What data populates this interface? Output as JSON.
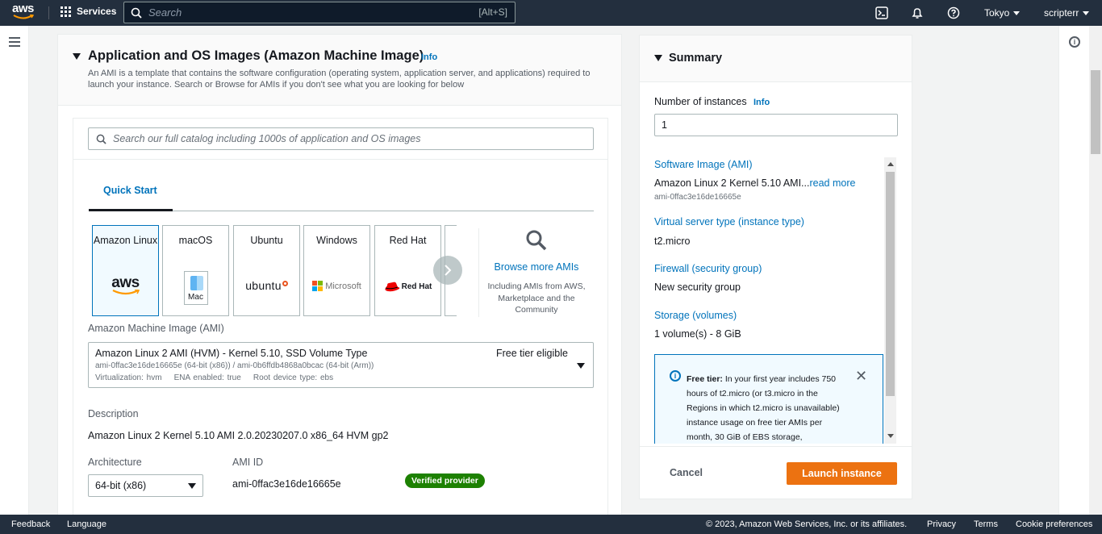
{
  "topnav": {
    "logo": "aws",
    "services": "Services",
    "search_placeholder": "Search",
    "search_shortcut": "[Alt+S]",
    "region": "Tokyo",
    "user": "scripterr",
    "icons": [
      "cloudshell-icon",
      "bell-icon",
      "help-icon"
    ]
  },
  "ami_section": {
    "title": "Application and OS Images (Amazon Machine Image)",
    "info": "Info",
    "description": "An AMI is a template that contains the software configuration (operating system, application server, and applications) required to launch your instance. Search or Browse for AMIs if you don't see what you are looking for below",
    "catalog_placeholder": "Search our full catalog including 1000s of application and OS images",
    "tab": "Quick Start",
    "os_cards": [
      {
        "name": "Amazon Linux",
        "logo": "aws"
      },
      {
        "name": "macOS",
        "logo": "Mac"
      },
      {
        "name": "Ubuntu",
        "logo": "ubuntu"
      },
      {
        "name": "Windows",
        "logo": "Microsoft"
      },
      {
        "name": "Red Hat",
        "logo": "Red Hat"
      },
      {
        "name": "S",
        "logo": ""
      }
    ],
    "browse_more": "Browse more AMIs",
    "browse_sub": "Including AMIs from AWS, Marketplace and the Community",
    "ami_label": "Amazon Machine Image (AMI)",
    "ami_name": "Amazon Linux 2 AMI (HVM) - Kernel 5.10, SSD Volume Type",
    "ami_free": "Free tier eligible",
    "ami_ids": "ami-0ffac3e16de16665e (64-bit (x86)) / ami-0b6ffdb4868a0bcac (64-bit (Arm))",
    "ami_virt": "Virtualization: hvm    ENA enabled: true    Root device type: ebs",
    "desc_label": "Description",
    "desc_value": "Amazon Linux 2 Kernel 5.10 AMI 2.0.20230207.0 x86_64 HVM gp2",
    "arch_label": "Architecture",
    "arch_value": "64-bit (x86)",
    "amiid_label": "AMI ID",
    "amiid_value": "ami-0ffac3e16de16665e",
    "verified": "Verified provider"
  },
  "summary": {
    "title": "Summary",
    "num_instances_label": "Number of instances",
    "num_instances_info": "Info",
    "num_instances_value": "1",
    "software_image_label": "Software Image (AMI)",
    "software_image_value": "Amazon Linux 2 Kernel 5.10 AMI...",
    "read_more": "read more",
    "software_image_id": "ami-0ffac3e16de16665e",
    "instance_type_label": "Virtual server type (instance type)",
    "instance_type_value": "t2.micro",
    "firewall_label": "Firewall (security group)",
    "firewall_value": "New security group",
    "storage_label": "Storage (volumes)",
    "storage_value": "1 volume(s) - 8 GiB",
    "free_tier_title": "Free tier:",
    "free_tier_text": " In your first year includes 750 hours of t2.micro (or t3.micro in the Regions in which t2.micro is unavailable) instance usage on free tier AMIs per month, 30 GiB of EBS storage,",
    "cancel": "Cancel",
    "launch": "Launch instance"
  },
  "footer": {
    "feedback": "Feedback",
    "language": "Language",
    "copyright": "© 2023, Amazon Web Services, Inc. or its affiliates.",
    "privacy": "Privacy",
    "terms": "Terms",
    "cookies": "Cookie preferences"
  },
  "colors": {
    "nav_bg": "#232f3e",
    "link": "#0073bb",
    "primary_button": "#ec7211",
    "verified": "#1d8102"
  }
}
